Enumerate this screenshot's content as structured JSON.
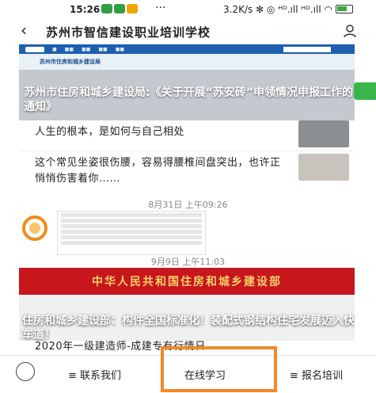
{
  "status_bar": {
    "time": "15:26",
    "dots": "···",
    "network": "3.2K/s ✻ ◎ ᴴᴰ.ıll ᴴᴰ.ıll ◠"
  },
  "header": {
    "title": "苏州市智信建设职业培训学校",
    "back_icon": "back-arrow-icon",
    "user_icon": "person-icon"
  },
  "card1": {
    "site_name": "苏州市住房和城乡建设局",
    "headline": "苏州市住房和城乡建设局:《关于开展“苏安砖”申领情况申报工作的通知》"
  },
  "articles": [
    {
      "title": "人生的根本，是如何与自己相处"
    },
    {
      "title": "这个常见坐姿很伤腰，容易得腰椎间盘突出，也许正悄悄伤害着你……"
    }
  ],
  "timestamps": {
    "t1": "8月31日 上午09:26",
    "t2": "9月9日 上午11:03"
  },
  "card2": {
    "banner": "中华人民共和国住房和城乡建设部",
    "headline": "住房和城乡建设部：构件全国标准化！装配式钢结构住宅发展迈入快车道！",
    "next_line": "2020年一级建造师-成建专有行情日"
  },
  "tabbar": {
    "tabs": [
      "≡ 联系我们",
      "在线学习",
      "≡ 报名培训"
    ]
  }
}
